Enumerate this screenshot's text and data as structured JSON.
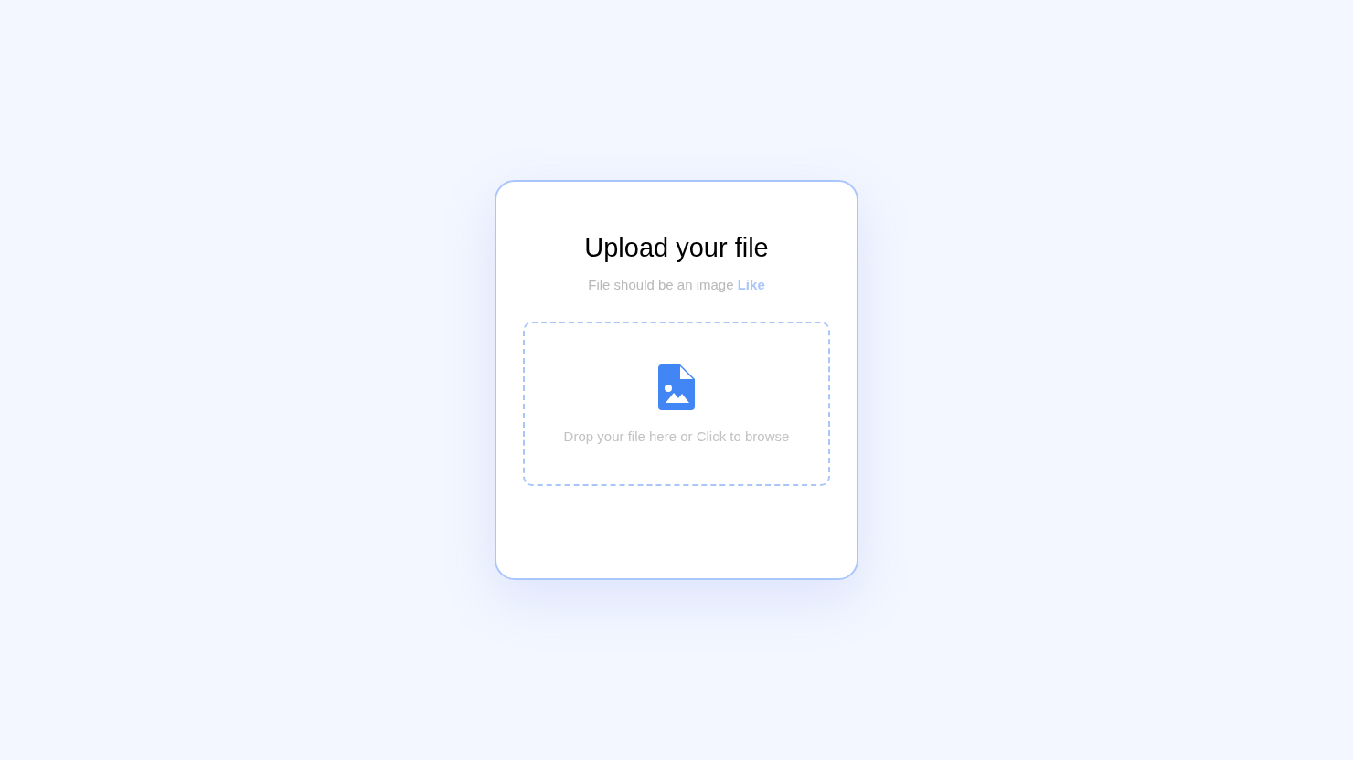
{
  "card": {
    "title": "Upload your file",
    "subtitle": "File should be an image **Like**",
    "dropzone": {
      "label": "Drop your file here or Click to browse"
    }
  }
}
